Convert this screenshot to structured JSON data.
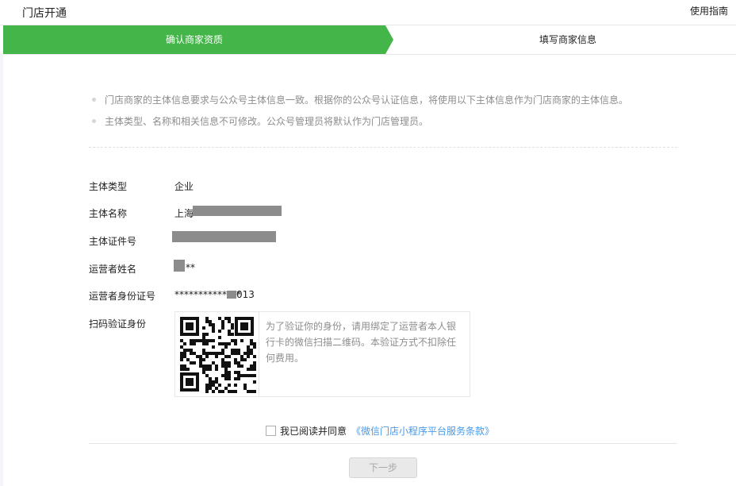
{
  "header": {
    "title": "门店开通",
    "guide_link": "使用指南"
  },
  "steps": [
    {
      "label": "确认商家资质",
      "active": true
    },
    {
      "label": "填写商家信息",
      "active": false
    }
  ],
  "tips": [
    "门店商家的主体信息要求与公众号主体信息一致。根据你的公众号认证信息，将使用以下主体信息作为门店商家的主体信息。",
    "主体类型、名称和相关信息不可修改。公众号管理员将默认作为门店管理员。"
  ],
  "fields": {
    "entity_type": {
      "label": "主体类型",
      "value": "企业"
    },
    "entity_name": {
      "label": "主体名称",
      "value": "上海"
    },
    "entity_cert": {
      "label": "主体证件号",
      "value": ""
    },
    "operator_name": {
      "label": "运营者姓名",
      "value": "**"
    },
    "operator_id": {
      "label": "运营者身份证号",
      "value": "**************",
      "value_suffix": "013"
    },
    "scan_verify": {
      "label": "扫码验证身份"
    }
  },
  "qr": {
    "description": "为了验证你的身份，请用绑定了运营者本人银行卡的微信扫描二维码。本验证方式不扣除任何费用。"
  },
  "agreement": {
    "text": "我已阅读并同意",
    "link": "《微信门店小程序平台服务条款》",
    "checked": false
  },
  "next_button": {
    "label": "下一步",
    "enabled": false
  },
  "colors": {
    "accent": "#44b549",
    "link": "#459ae9",
    "muted": "#8d8d8d",
    "mask": "#8c8c8c"
  }
}
